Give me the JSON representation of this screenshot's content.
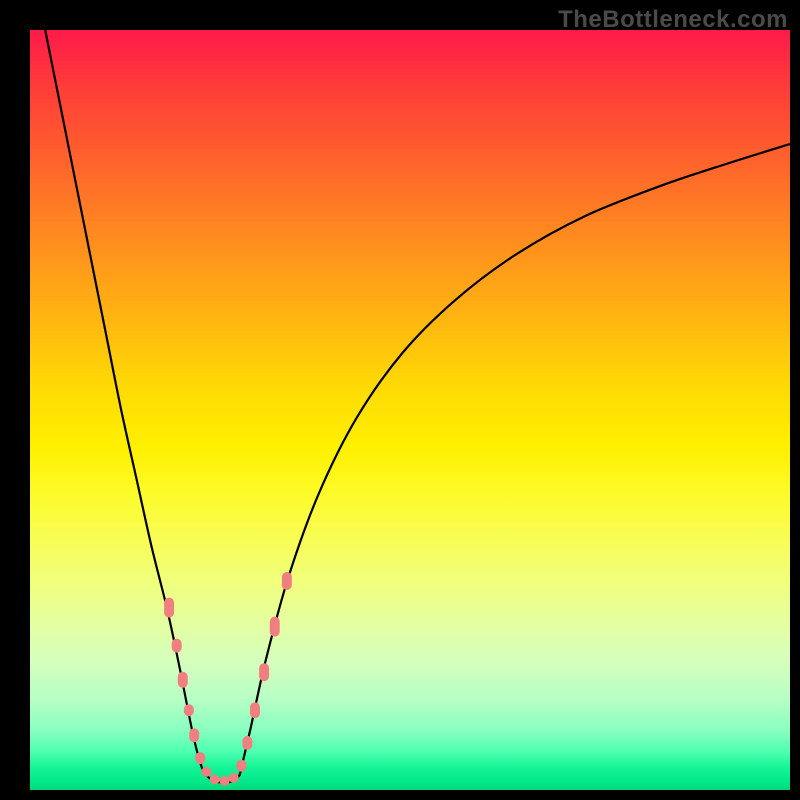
{
  "watermark": "TheBottleneck.com",
  "gradient_colors": [
    "#ff1a4a",
    "#ff3a3a",
    "#ff5a2f",
    "#ff7a25",
    "#ff9a1a",
    "#ffba0f",
    "#ffda05",
    "#fff000",
    "#fdfb2a",
    "#f8fd55",
    "#f0ff7f",
    "#e4ffa0",
    "#d5ffbc",
    "#b8ffc5",
    "#8affc0",
    "#4dffb0",
    "#15f596",
    "#00e888",
    "#00d87a"
  ],
  "chart_data": {
    "type": "line",
    "title": "",
    "xlabel": "",
    "ylabel": "",
    "xlim": [
      0,
      100
    ],
    "ylim": [
      0,
      100
    ],
    "grid": false,
    "legend": false,
    "series": [
      {
        "name": "left-curve",
        "x": [
          2.0,
          4.0,
          6.0,
          8.0,
          10.0,
          12.0,
          14.0,
          16.0,
          18.0,
          19.5,
          20.5,
          21.3,
          22.0,
          22.6,
          23.1
        ],
        "y": [
          100.0,
          90.0,
          80.0,
          70.0,
          60.0,
          50.0,
          41.0,
          32.0,
          24.0,
          17.0,
          12.0,
          8.0,
          5.0,
          3.0,
          2.0
        ]
      },
      {
        "name": "valley-floor",
        "x": [
          23.1,
          24.0,
          25.0,
          26.0,
          27.0,
          27.6
        ],
        "y": [
          2.0,
          1.3,
          1.0,
          1.0,
          1.3,
          2.0
        ]
      },
      {
        "name": "right-curve",
        "x": [
          27.6,
          29.0,
          31.0,
          34.0,
          38.0,
          43.0,
          49.0,
          56.0,
          64.0,
          73.0,
          83.0,
          92.0,
          100.0
        ],
        "y": [
          2.0,
          8.0,
          17.0,
          28.0,
          39.0,
          49.0,
          57.5,
          64.5,
          70.5,
          75.5,
          79.5,
          82.5,
          85.0
        ]
      }
    ],
    "markers": {
      "name": "salmon-dots",
      "color": "#f08080",
      "approx_size_px": 10,
      "points": [
        {
          "x": 18.3,
          "y": 24.0,
          "h": 20
        },
        {
          "x": 19.3,
          "y": 19.0,
          "h": 14
        },
        {
          "x": 20.1,
          "y": 14.5,
          "h": 16
        },
        {
          "x": 20.9,
          "y": 10.5,
          "h": 12
        },
        {
          "x": 21.6,
          "y": 7.2,
          "h": 14
        },
        {
          "x": 22.4,
          "y": 4.2,
          "h": 12
        },
        {
          "x": 23.2,
          "y": 2.4,
          "h": 10
        },
        {
          "x": 24.3,
          "y": 1.4,
          "h": 10
        },
        {
          "x": 25.6,
          "y": 1.2,
          "h": 10
        },
        {
          "x": 26.8,
          "y": 1.6,
          "h": 10
        },
        {
          "x": 27.8,
          "y": 3.2,
          "h": 12
        },
        {
          "x": 28.6,
          "y": 6.2,
          "h": 14
        },
        {
          "x": 29.6,
          "y": 10.5,
          "h": 16
        },
        {
          "x": 30.8,
          "y": 15.5,
          "h": 18
        },
        {
          "x": 32.2,
          "y": 21.5,
          "h": 20
        },
        {
          "x": 33.8,
          "y": 27.5,
          "h": 18
        }
      ]
    }
  }
}
